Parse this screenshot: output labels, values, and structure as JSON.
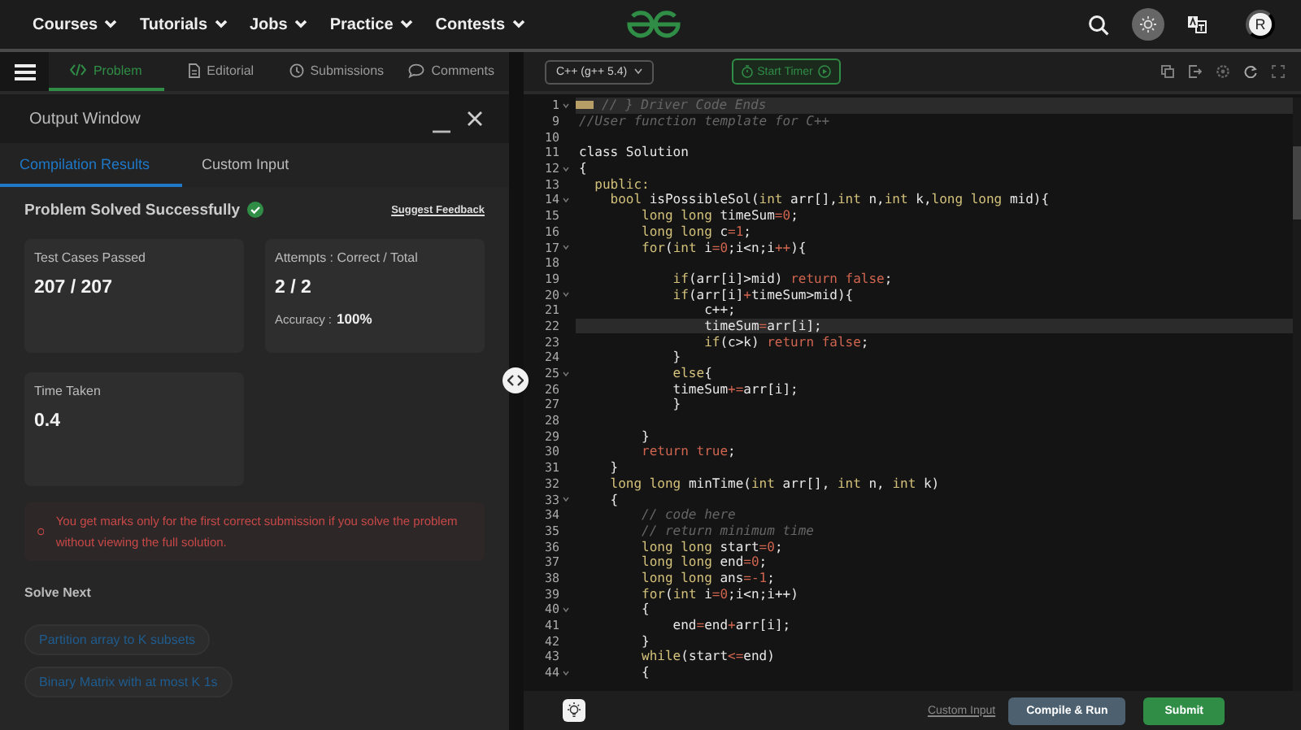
{
  "nav": {
    "menu": [
      {
        "label": "Courses"
      },
      {
        "label": "Tutorials"
      },
      {
        "label": "Jobs"
      },
      {
        "label": "Practice"
      },
      {
        "label": "Contests"
      }
    ],
    "avatar": "R"
  },
  "problem_tabs": [
    {
      "label": "Problem",
      "kind": "code",
      "selected": true
    },
    {
      "label": "Editorial",
      "kind": "document",
      "selected": false
    },
    {
      "label": "Submissions",
      "kind": "clock",
      "selected": false
    },
    {
      "label": "Comments",
      "kind": "comment",
      "selected": false
    }
  ],
  "output_window": {
    "title": "Output Window",
    "tabs": [
      {
        "label": "Compilation Results",
        "selected": true
      },
      {
        "label": "Custom Input",
        "selected": false
      }
    ],
    "status": "Problem Solved Successfully",
    "feedback_link": "Suggest Feedback",
    "stats": [
      {
        "label": "Test Cases Passed",
        "value": "207 / 207"
      },
      {
        "label": "Attempts : Correct / Total",
        "value": "2 / 2",
        "detail_label": "Accuracy :",
        "detail_value": "100%"
      },
      {
        "label": "Time Taken",
        "value": "0.4"
      }
    ],
    "notice": "You get marks only for the first correct submission if you solve the problem without viewing the full solution.",
    "solve_next": {
      "title": "Solve Next",
      "items": [
        "Partition array to K subsets",
        "Binary Matrix with at most K 1s"
      ]
    }
  },
  "editor": {
    "language": "C++ (g++ 5.4)",
    "timer_button": "Start Timer",
    "lines": [
      {
        "number": "1",
        "fold": true,
        "folded": true,
        "highlighted": true,
        "tokens": [
          {
            "kind": "comment",
            "text": "// } Driver Code Ends"
          }
        ]
      },
      {
        "number": "9",
        "fold": false,
        "folded": false,
        "highlighted": false,
        "tokens": [
          {
            "kind": "comment",
            "text": "//User function template for C++"
          }
        ]
      },
      {
        "number": "10",
        "fold": false,
        "folded": false,
        "highlighted": false
      },
      {
        "number": "11",
        "fold": false,
        "folded": false,
        "highlighted": false,
        "tokens": [
          {
            "kind": "plain",
            "text": "class Solution"
          }
        ]
      },
      {
        "number": "12",
        "fold": true,
        "folded": false,
        "highlighted": false,
        "tokens": [
          {
            "kind": "plain",
            "text": "{"
          }
        ]
      },
      {
        "number": "13",
        "fold": false,
        "folded": false,
        "highlighted": false,
        "tokens": [
          {
            "kind": "keyword",
            "text": "  public:"
          }
        ]
      },
      {
        "number": "14",
        "fold": true,
        "folded": false,
        "highlighted": false,
        "tokens": [
          {
            "kind": "keyword",
            "text": "    bool"
          },
          {
            "kind": "plain",
            "text": " isPossibleSol("
          },
          {
            "kind": "keyword",
            "text": "int"
          },
          {
            "kind": "plain",
            "text": " arr[],"
          },
          {
            "kind": "keyword",
            "text": "int"
          },
          {
            "kind": "plain",
            "text": " n,"
          },
          {
            "kind": "keyword",
            "text": "int"
          },
          {
            "kind": "plain",
            "text": " k,"
          },
          {
            "kind": "keyword",
            "text": "long long"
          },
          {
            "kind": "plain",
            "text": " mid){"
          }
        ]
      },
      {
        "number": "15",
        "fold": false,
        "folded": false,
        "highlighted": false,
        "tokens": [
          {
            "kind": "keyword",
            "text": "        long long"
          },
          {
            "kind": "plain",
            "text": " timeSum"
          },
          {
            "kind": "literal",
            "text": "=0"
          },
          {
            "kind": "plain",
            "text": ";"
          }
        ]
      },
      {
        "number": "16",
        "fold": false,
        "folded": false,
        "highlighted": false,
        "tokens": [
          {
            "kind": "keyword",
            "text": "        long long"
          },
          {
            "kind": "plain",
            "text": " c"
          },
          {
            "kind": "literal",
            "text": "=1"
          },
          {
            "kind": "plain",
            "text": ";"
          }
        ]
      },
      {
        "number": "17",
        "fold": true,
        "folded": false,
        "highlighted": false,
        "tokens": [
          {
            "kind": "keyword",
            "text": "        for"
          },
          {
            "kind": "plain",
            "text": "("
          },
          {
            "kind": "keyword",
            "text": "int"
          },
          {
            "kind": "plain",
            "text": " i"
          },
          {
            "kind": "literal",
            "text": "=0"
          },
          {
            "kind": "plain",
            "text": ";i<n;i"
          },
          {
            "kind": "literal",
            "text": "++"
          },
          {
            "kind": "plain",
            "text": "){"
          }
        ]
      },
      {
        "number": "18",
        "fold": false,
        "folded": false,
        "highlighted": false
      },
      {
        "number": "19",
        "fold": false,
        "folded": false,
        "highlighted": false,
        "tokens": [
          {
            "kind": "keyword",
            "text": "            if"
          },
          {
            "kind": "plain",
            "text": "(arr[i]>mid) "
          },
          {
            "kind": "literal",
            "text": "return false"
          },
          {
            "kind": "plain",
            "text": ";"
          }
        ]
      },
      {
        "number": "20",
        "fold": true,
        "folded": false,
        "highlighted": false,
        "tokens": [
          {
            "kind": "keyword",
            "text": "            if"
          },
          {
            "kind": "plain",
            "text": "(arr[i]"
          },
          {
            "kind": "literal",
            "text": "+"
          },
          {
            "kind": "plain",
            "text": "timeSum>mid){"
          }
        ]
      },
      {
        "number": "21",
        "fold": false,
        "folded": false,
        "highlighted": false,
        "tokens": [
          {
            "kind": "plain",
            "text": "                c++;"
          }
        ]
      },
      {
        "number": "22",
        "fold": false,
        "folded": false,
        "highlighted": true,
        "tokens": [
          {
            "kind": "plain",
            "text": "                timeSum"
          },
          {
            "kind": "literal",
            "text": "="
          },
          {
            "kind": "plain",
            "text": "arr[i];"
          }
        ]
      },
      {
        "number": "23",
        "fold": false,
        "folded": false,
        "highlighted": false,
        "tokens": [
          {
            "kind": "keyword",
            "text": "                if"
          },
          {
            "kind": "plain",
            "text": "(c>k) "
          },
          {
            "kind": "literal",
            "text": "return false"
          },
          {
            "kind": "plain",
            "text": ";"
          }
        ]
      },
      {
        "number": "24",
        "fold": false,
        "folded": false,
        "highlighted": false,
        "tokens": [
          {
            "kind": "plain",
            "text": "            }"
          }
        ]
      },
      {
        "number": "25",
        "fold": true,
        "folded": false,
        "highlighted": false,
        "tokens": [
          {
            "kind": "keyword",
            "text": "            else"
          },
          {
            "kind": "plain",
            "text": "{"
          }
        ]
      },
      {
        "number": "26",
        "fold": false,
        "folded": false,
        "highlighted": false,
        "tokens": [
          {
            "kind": "plain",
            "text": "            timeSum"
          },
          {
            "kind": "literal",
            "text": "+="
          },
          {
            "kind": "plain",
            "text": "arr[i];"
          }
        ]
      },
      {
        "number": "27",
        "fold": false,
        "folded": false,
        "highlighted": false,
        "tokens": [
          {
            "kind": "plain",
            "text": "            }"
          }
        ]
      },
      {
        "number": "28",
        "fold": false,
        "folded": false,
        "highlighted": false
      },
      {
        "number": "29",
        "fold": false,
        "folded": false,
        "highlighted": false,
        "tokens": [
          {
            "kind": "plain",
            "text": "        }"
          }
        ]
      },
      {
        "number": "30",
        "fold": false,
        "folded": false,
        "highlighted": false,
        "tokens": [
          {
            "kind": "literal",
            "text": "        return true"
          },
          {
            "kind": "plain",
            "text": ";"
          }
        ]
      },
      {
        "number": "31",
        "fold": false,
        "folded": false,
        "highlighted": false,
        "tokens": [
          {
            "kind": "plain",
            "text": "    }"
          }
        ]
      },
      {
        "number": "32",
        "fold": false,
        "folded": false,
        "highlighted": false,
        "tokens": [
          {
            "kind": "keyword",
            "text": "    long long"
          },
          {
            "kind": "plain",
            "text": " minTime("
          },
          {
            "kind": "keyword",
            "text": "int"
          },
          {
            "kind": "plain",
            "text": " arr[], "
          },
          {
            "kind": "keyword",
            "text": "int"
          },
          {
            "kind": "plain",
            "text": " n, "
          },
          {
            "kind": "keyword",
            "text": "int"
          },
          {
            "kind": "plain",
            "text": " k)"
          }
        ]
      },
      {
        "number": "33",
        "fold": true,
        "folded": false,
        "highlighted": false,
        "tokens": [
          {
            "kind": "plain",
            "text": "    {"
          }
        ]
      },
      {
        "number": "34",
        "fold": false,
        "folded": false,
        "highlighted": false,
        "tokens": [
          {
            "kind": "comment",
            "text": "        // code here"
          }
        ]
      },
      {
        "number": "35",
        "fold": false,
        "folded": false,
        "highlighted": false,
        "tokens": [
          {
            "kind": "comment",
            "text": "        // return minimum time"
          }
        ]
      },
      {
        "number": "36",
        "fold": false,
        "folded": false,
        "highlighted": false,
        "tokens": [
          {
            "kind": "keyword",
            "text": "        long long"
          },
          {
            "kind": "plain",
            "text": " start"
          },
          {
            "kind": "literal",
            "text": "=0"
          },
          {
            "kind": "plain",
            "text": ";"
          }
        ]
      },
      {
        "number": "37",
        "fold": false,
        "folded": false,
        "highlighted": false,
        "tokens": [
          {
            "kind": "keyword",
            "text": "        long long"
          },
          {
            "kind": "plain",
            "text": " end"
          },
          {
            "kind": "literal",
            "text": "=0"
          },
          {
            "kind": "plain",
            "text": ";"
          }
        ]
      },
      {
        "number": "38",
        "fold": false,
        "folded": false,
        "highlighted": false,
        "tokens": [
          {
            "kind": "keyword",
            "text": "        long long"
          },
          {
            "kind": "plain",
            "text": " ans"
          },
          {
            "kind": "literal",
            "text": "=-1"
          },
          {
            "kind": "plain",
            "text": ";"
          }
        ]
      },
      {
        "number": "39",
        "fold": false,
        "folded": false,
        "highlighted": false,
        "tokens": [
          {
            "kind": "keyword",
            "text": "        for"
          },
          {
            "kind": "plain",
            "text": "("
          },
          {
            "kind": "keyword",
            "text": "int"
          },
          {
            "kind": "plain",
            "text": " i"
          },
          {
            "kind": "literal",
            "text": "=0"
          },
          {
            "kind": "plain",
            "text": ";i<n;i++)"
          }
        ]
      },
      {
        "number": "40",
        "fold": true,
        "folded": false,
        "highlighted": false,
        "tokens": [
          {
            "kind": "plain",
            "text": "        {"
          }
        ]
      },
      {
        "number": "41",
        "fold": false,
        "folded": false,
        "highlighted": false,
        "tokens": [
          {
            "kind": "plain",
            "text": "            end"
          },
          {
            "kind": "literal",
            "text": "="
          },
          {
            "kind": "plain",
            "text": "end"
          },
          {
            "kind": "literal",
            "text": "+"
          },
          {
            "kind": "plain",
            "text": "arr[i];"
          }
        ]
      },
      {
        "number": "42",
        "fold": false,
        "folded": false,
        "highlighted": false,
        "tokens": [
          {
            "kind": "plain",
            "text": "        }"
          }
        ]
      },
      {
        "number": "43",
        "fold": false,
        "folded": false,
        "highlighted": false,
        "tokens": [
          {
            "kind": "keyword",
            "text": "        while"
          },
          {
            "kind": "plain",
            "text": "(start"
          },
          {
            "kind": "literal",
            "text": "<="
          },
          {
            "kind": "plain",
            "text": "end)"
          }
        ]
      },
      {
        "number": "44",
        "fold": true,
        "folded": false,
        "highlighted": false,
        "tokens": [
          {
            "kind": "plain",
            "text": "        {"
          }
        ]
      }
    ],
    "footer": {
      "custom_input": "Custom Input",
      "compile": "Compile & Run",
      "submit": "Submit"
    }
  }
}
